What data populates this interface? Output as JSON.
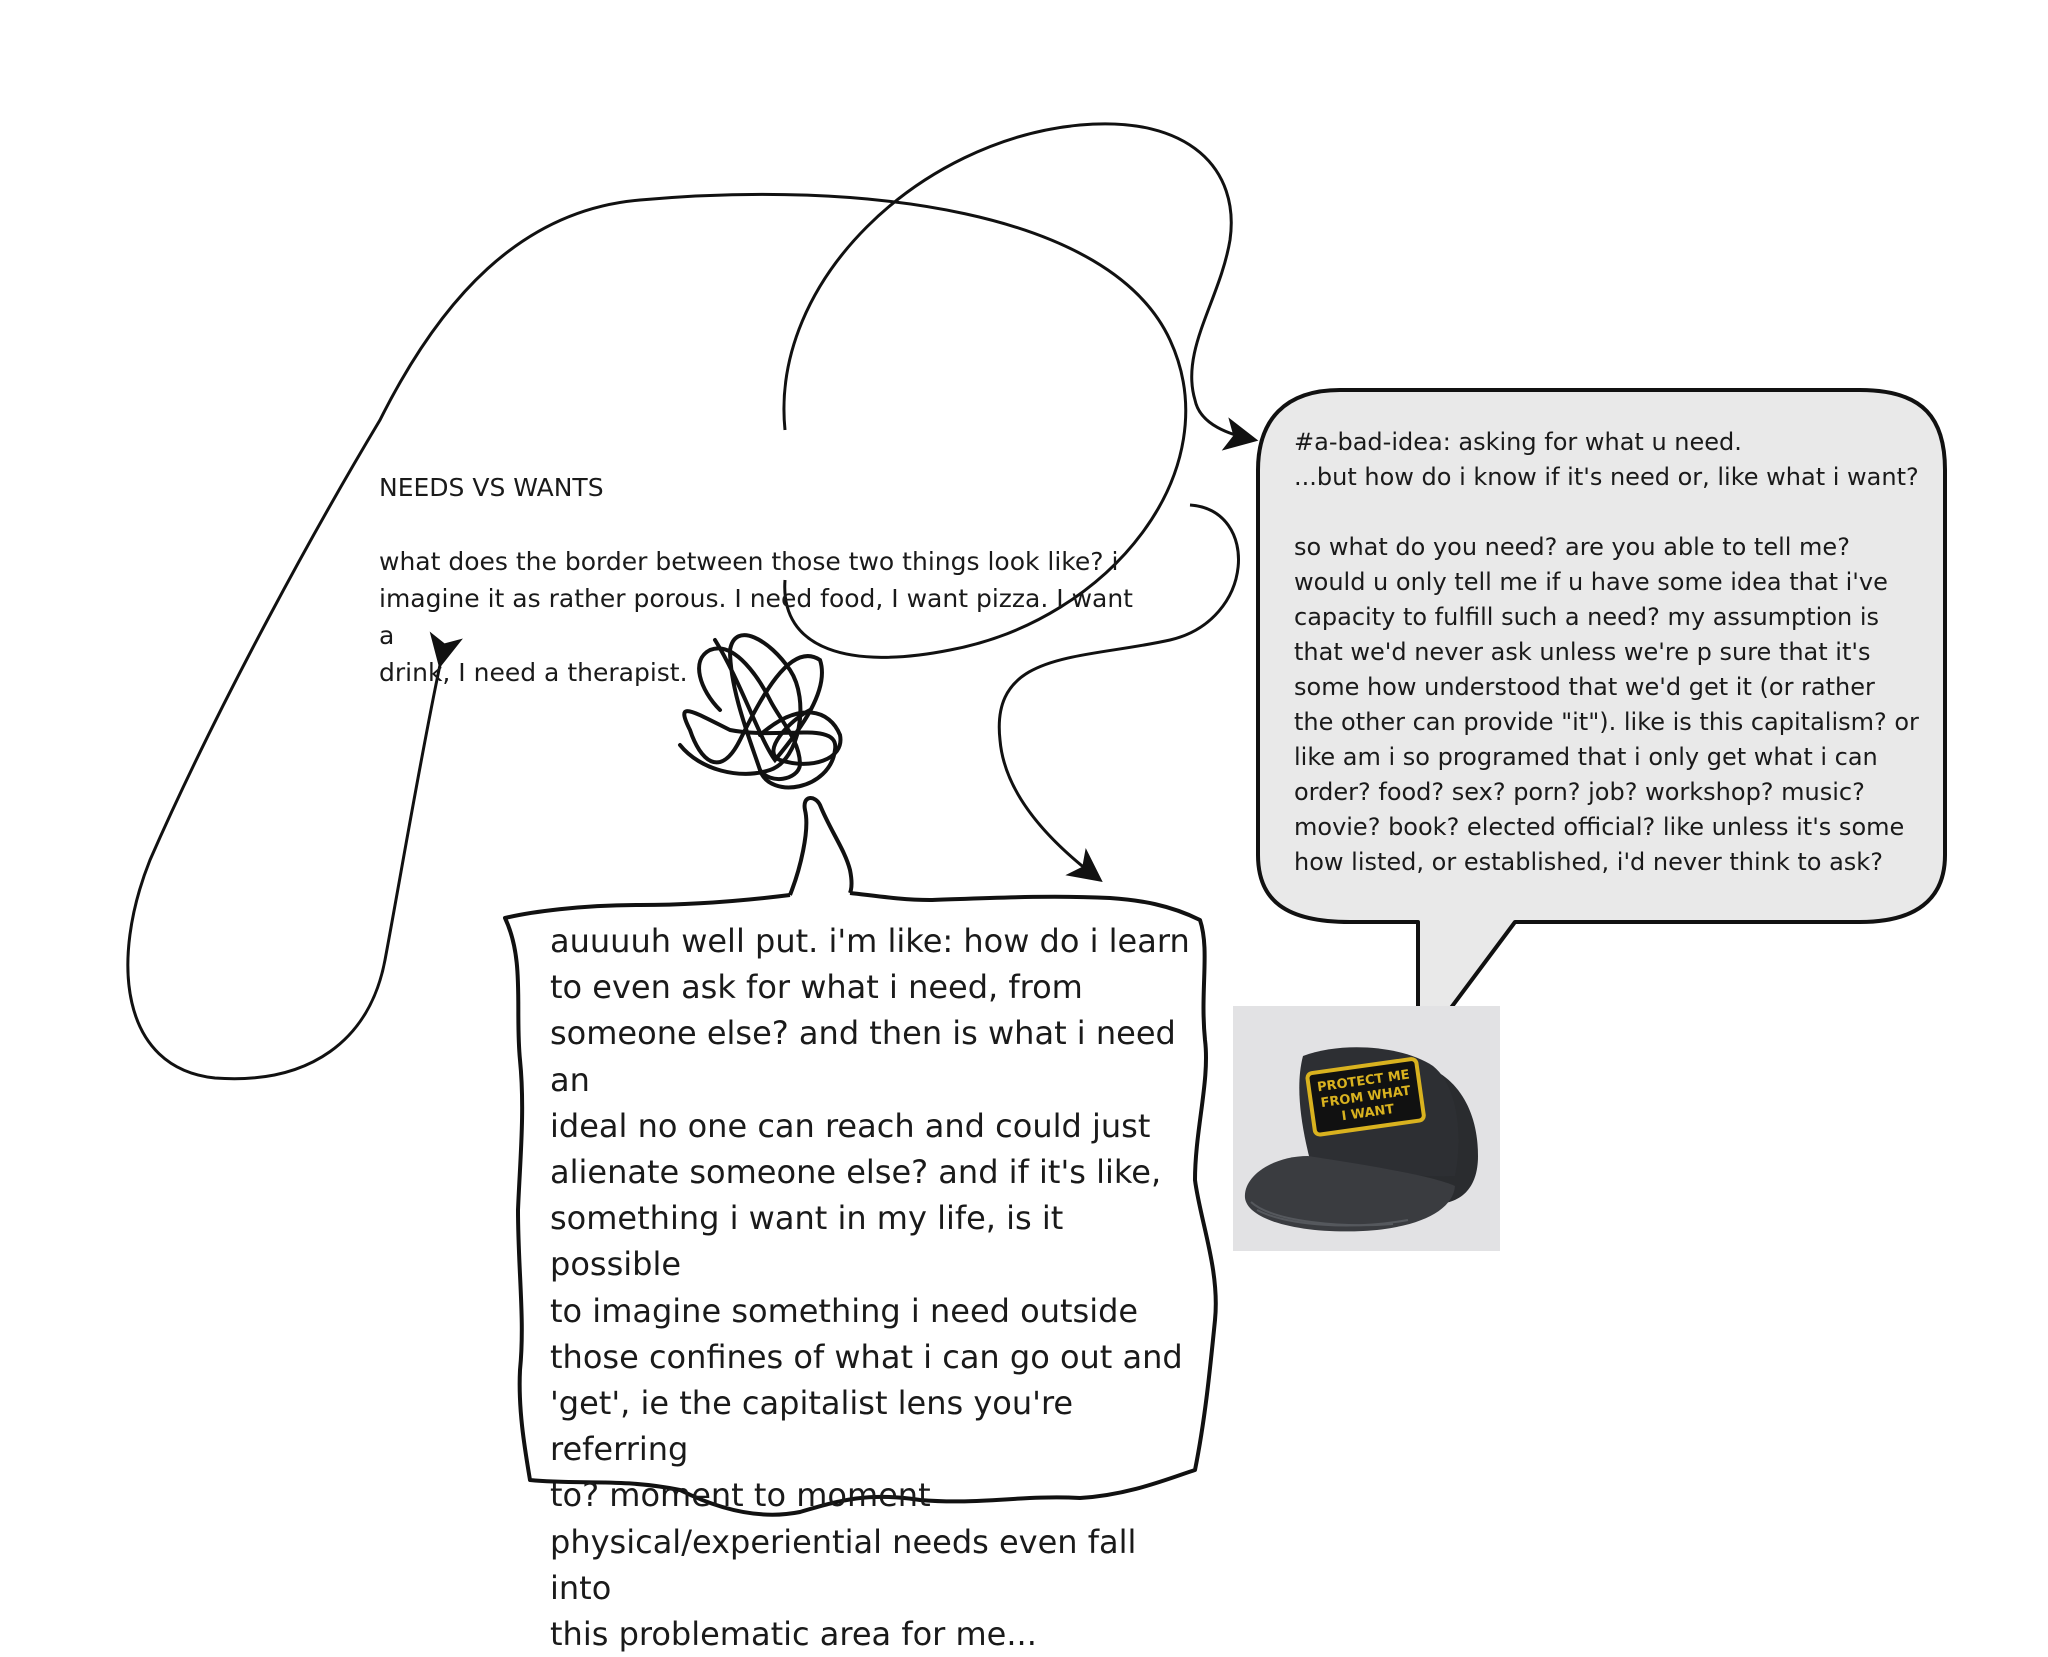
{
  "notes": {
    "needs_wants": {
      "title": "NEEDS VS WANTS",
      "body": "what does the border between those two things look like? i\nimagine it as rather porous. I need food, I want pizza. I want a\ndrink, I need a therapist."
    },
    "bad_idea": {
      "body": "#a-bad-idea: asking for what u need.\n...but how do i know if it's need or, like what i want?\n\nso what do you need? are you able to tell me?\nwould u only tell me if u have some idea that i've\ncapacity to fulfill such a need? my assumption is\nthat we'd never ask unless we're p sure that it's\nsome how understood that we'd get it (or rather\nthe other can provide \"it\"). like is this capitalism? or\nlike am i so programed that i only get what i can\norder? food? sex? porn? job? workshop? music?\nmovie? book? elected official? like unless it's some\nhow listed, or established, i'd never think to ask?"
    },
    "reply": {
      "body": "auuuuh well put. i'm like: how do i learn\nto even ask for what i need, from\nsomeone else? and then is what i need an\nideal no one can reach and could just\nalienate someone else? and if it's like,\nsomething i want in my life, is it possible\nto imagine something i need outside\nthose confines of what i can go out and\n'get', ie the capitalist lens you're referring\nto? moment to moment\nphysical/experiential needs even fall into\nthis problematic area for me..."
    }
  },
  "hat_photo": {
    "patch_text": [
      "PROTECT ME",
      "FROM WHAT",
      "I WANT"
    ],
    "colors": {
      "backdrop": "#e2e2e4",
      "cap": "#2b2d30",
      "patch": "#111111",
      "stitching": "#d9b21f"
    }
  },
  "colors": {
    "ink": "#111111",
    "bubble_fill": "#e9e9e9",
    "background": "#ffffff"
  }
}
